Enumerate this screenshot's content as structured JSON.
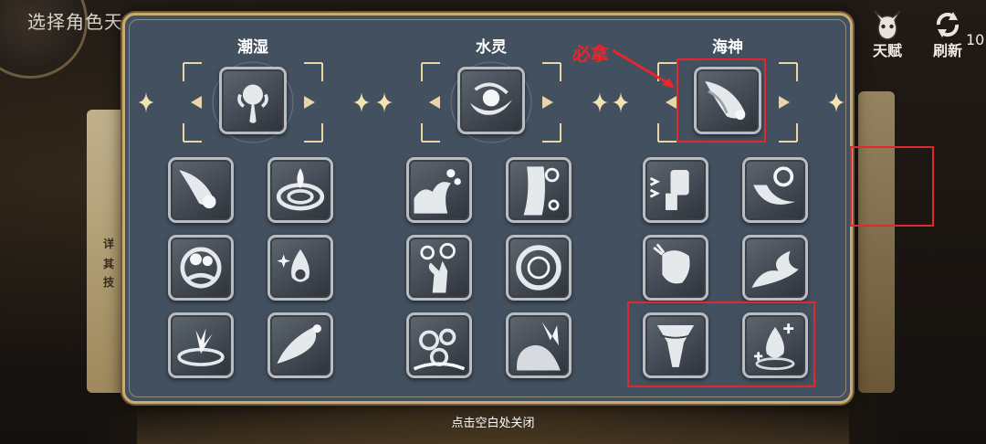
{
  "screen": {
    "background_title": "选择角色天",
    "left_card_chars": [
      "详",
      "其",
      "技"
    ],
    "talent_button": {
      "label": "天赋",
      "icon": "horned-helmet-icon"
    },
    "refresh_button": {
      "label": "刷新",
      "icon": "refresh-arrows-icon"
    },
    "refresh_count": "10"
  },
  "panel": {
    "columns": [
      {
        "title": "潮湿",
        "main_skill": {
          "icon": "water-flower-burst-icon"
        },
        "skills": [
          {
            "icon": "falling-comet-icon"
          },
          {
            "icon": "whirlpool-drop-icon"
          },
          {
            "icon": "orb-vortex-icon"
          },
          {
            "icon": "sparkle-droplet-icon"
          },
          {
            "icon": "splash-ring-icon"
          },
          {
            "icon": "water-wave-burst-icon"
          }
        ]
      },
      {
        "title": "水灵",
        "main_skill": {
          "icon": "water-orb-swirl-icon"
        },
        "skills": [
          {
            "icon": "wave-crest-icon"
          },
          {
            "icon": "rising-bubble-column-icon"
          },
          {
            "icon": "hand-with-orbs-icon"
          },
          {
            "icon": "bubble-vortex-icon"
          },
          {
            "icon": "bubble-cluster-icon"
          },
          {
            "icon": "sleeping-wave-icon"
          }
        ]
      },
      {
        "title": "海神",
        "main_skill": {
          "icon": "sea-god-tidal-strike-icon",
          "highlighted": true
        },
        "skills": [
          {
            "icon": "dashing-hammer-icon",
            "highlighted": false
          },
          {
            "icon": "spiral-shell-splash-icon",
            "highlighted": true
          },
          {
            "icon": "tidal-fist-icon",
            "highlighted": false
          },
          {
            "icon": "storm-wave-icon",
            "highlighted": false
          },
          {
            "icon": "water-tornado-icon",
            "highlighted": true
          },
          {
            "icon": "healing-droplet-icon",
            "highlighted": true
          }
        ]
      }
    ],
    "annotation": {
      "label": "必拿",
      "color": "#e8262c"
    }
  },
  "close_hint": "点击空白处关闭"
}
